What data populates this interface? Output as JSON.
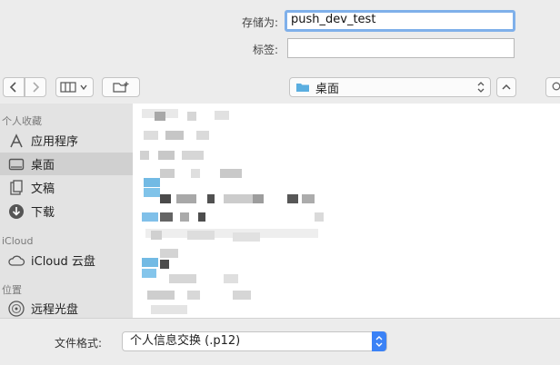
{
  "save": {
    "label": "存储为:",
    "value": "push_dev_test"
  },
  "tags": {
    "label": "标签:",
    "value": ""
  },
  "toolbar": {
    "location": "桌面"
  },
  "sidebar": {
    "favorites_header": "个人收藏",
    "favorites": [
      {
        "label": "应用程序",
        "icon": "applications-icon"
      },
      {
        "label": "桌面",
        "icon": "desktop-icon",
        "selected": true
      },
      {
        "label": "文稿",
        "icon": "documents-icon"
      },
      {
        "label": "下载",
        "icon": "downloads-icon"
      }
    ],
    "icloud_header": "iCloud",
    "icloud": [
      {
        "label": "iCloud 云盘",
        "icon": "cloud-icon"
      }
    ],
    "locations_header": "位置",
    "locations": [
      {
        "label": "远程光盘",
        "icon": "disc-icon"
      }
    ]
  },
  "format": {
    "label": "文件格式:",
    "value": "个人信息交换 (.p12)"
  },
  "colors": {
    "accent": "#3b82f6",
    "focus_ring": "#7fb0ea",
    "folder": "#5aaee0"
  }
}
